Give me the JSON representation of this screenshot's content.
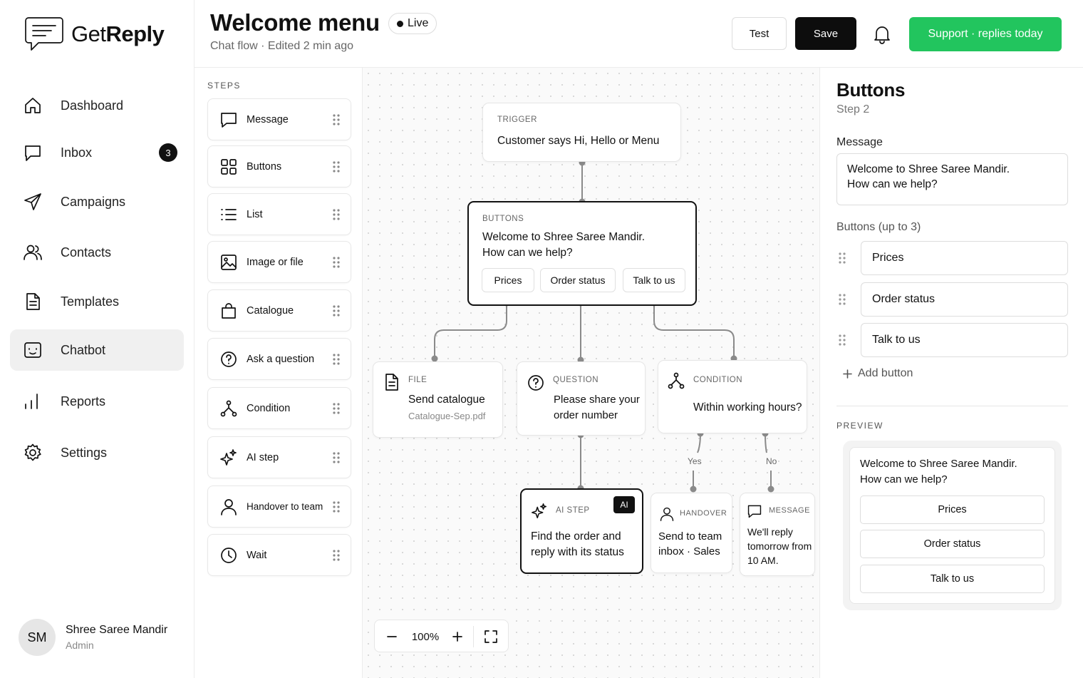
{
  "app": {
    "logo_light": "Get",
    "logo_bold": "Reply"
  },
  "sidebar": {
    "items": [
      {
        "label": "Dashboard",
        "icon": "home-icon"
      },
      {
        "label": "Inbox",
        "icon": "chat-icon",
        "badge": "3"
      },
      {
        "label": "Campaigns",
        "icon": "send-icon"
      },
      {
        "label": "Contacts",
        "icon": "users-icon"
      },
      {
        "label": "Templates",
        "icon": "document-icon"
      },
      {
        "label": "Chatbot",
        "icon": "bot-icon",
        "active": true
      },
      {
        "label": "Reports",
        "icon": "bar-chart-icon"
      },
      {
        "label": "Settings",
        "icon": "gear-icon"
      }
    ],
    "user": {
      "initials": "SM",
      "name": "Shree Saree Mandir",
      "role": "Admin"
    }
  },
  "header": {
    "title": "Welcome menu",
    "status": "Live",
    "subtitle": "Chat flow · Edited 2 min ago",
    "test_label": "Test",
    "save_label": "Save",
    "support_label": "Support · replies today"
  },
  "steps": {
    "heading": "STEPS",
    "items": [
      {
        "label": "Message",
        "icon": "message-icon"
      },
      {
        "label": "Buttons",
        "icon": "grid-icon"
      },
      {
        "label": "List",
        "icon": "list-icon"
      },
      {
        "label": "Image or file",
        "icon": "image-icon"
      },
      {
        "label": "Catalogue",
        "icon": "bag-icon"
      },
      {
        "label": "Ask a question",
        "icon": "question-icon"
      },
      {
        "label": "Condition",
        "icon": "branch-icon"
      },
      {
        "label": "AI step",
        "icon": "sparkle-icon"
      },
      {
        "label": "Handover to team",
        "icon": "person-icon"
      },
      {
        "label": "Wait",
        "icon": "clock-icon"
      }
    ]
  },
  "canvas": {
    "trigger": {
      "type": "TRIGGER",
      "text": "Customer says Hi, Hello or Menu"
    },
    "buttons_node": {
      "type": "BUTTONS",
      "line1": "Welcome to Shree Saree Mandir.",
      "line2": "How can we help?",
      "chips": [
        "Prices",
        "Order status",
        "Talk to us"
      ]
    },
    "file_node": {
      "type": "FILE",
      "text": "Send catalogue",
      "sub": "Catalogue-Sep.pdf"
    },
    "question_node": {
      "type": "QUESTION",
      "line1": "Please share your",
      "line2": "order number"
    },
    "condition_node": {
      "type": "CONDITION",
      "text": "Within working hours?",
      "yes": "Yes",
      "no": "No"
    },
    "ai_node": {
      "type": "AI STEP",
      "badge": "AI",
      "line1": "Find the order and",
      "line2": "reply with its status"
    },
    "handover_node": {
      "type": "HANDOVER",
      "line1": "Send to team",
      "line2": "inbox · Sales"
    },
    "message_node": {
      "type": "MESSAGE",
      "line1": "We'll reply",
      "line2": "tomorrow from",
      "line3": "10 AM."
    },
    "zoom": "100%"
  },
  "panel": {
    "title": "Buttons",
    "subtitle": "Step 2",
    "message_label": "Message",
    "message_line1": "Welcome to Shree Saree Mandir.",
    "message_line2": "How can we help?",
    "buttons_label": "Buttons (up to 3)",
    "buttons": [
      "Prices",
      "Order status",
      "Talk to us"
    ],
    "add_button": "Add button",
    "preview_heading": "PREVIEW",
    "preview_line1": "Welcome to Shree Saree Mandir.",
    "preview_line2": "How can we help?",
    "preview_buttons": [
      "Prices",
      "Order status",
      "Talk to us"
    ]
  },
  "colors": {
    "accent_green": "#22c55e",
    "dark": "#0d0d0d"
  }
}
